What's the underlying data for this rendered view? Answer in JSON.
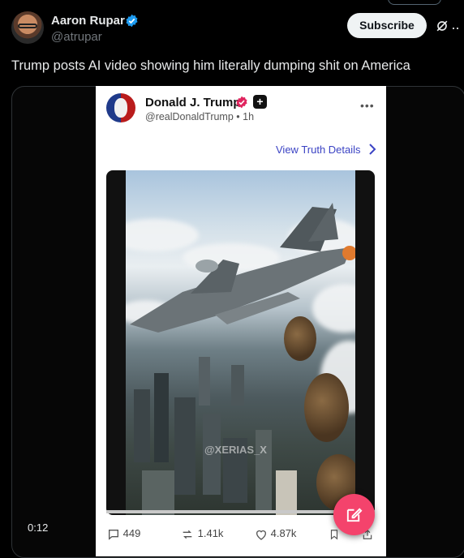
{
  "author": {
    "name": "Aaron Rupar",
    "handle": "@atrupar",
    "subscribe_label": "Subscribe"
  },
  "tweet": {
    "text": "Trump posts AI video showing him literally dumping shit on America"
  },
  "embedded_post": {
    "name": "Donald J. Trump",
    "handle_time": "@realDonaldTrump • 1h",
    "more": "•••",
    "view_details": "View Truth Details",
    "watermark": "@XERIAS_X",
    "replies": "449",
    "retruths": "1.41k",
    "likes": "4.87k"
  },
  "video": {
    "time": "0:12"
  },
  "colors": {
    "verified_blue": "#1d9bf0",
    "compose_pink": "#f4436c",
    "truth_link": "#3b43c4"
  },
  "icons": [
    "verified-icon",
    "grok-icon",
    "more-icon",
    "chevron-right-icon",
    "reply-icon",
    "retruth-icon",
    "like-icon",
    "bookmark-icon",
    "share-icon",
    "compose-icon"
  ]
}
